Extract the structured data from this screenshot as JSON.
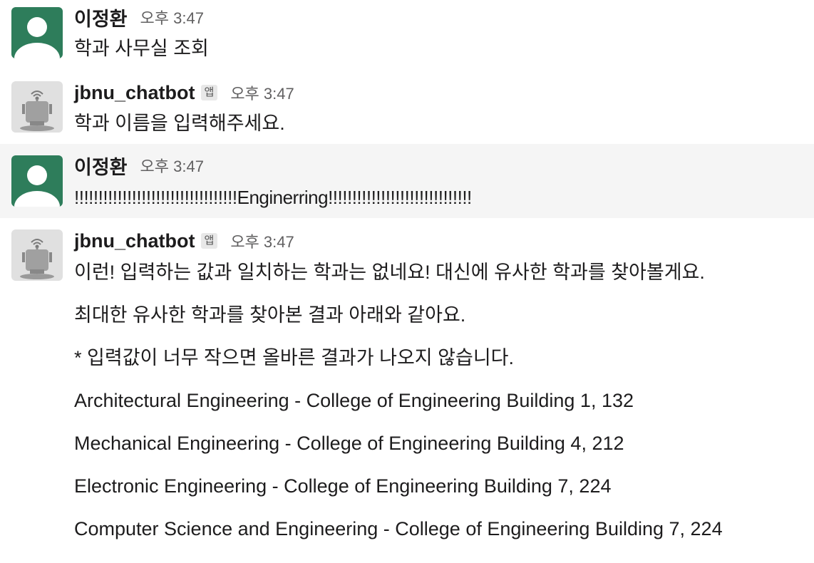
{
  "messages": [
    {
      "sender": "이정환",
      "time": "오후 3:47",
      "lines": [
        "학과 사무실 조회"
      ]
    },
    {
      "sender": "jbnu_chatbot",
      "badge": "앱",
      "time": "오후 3:47",
      "lines": [
        "학과 이름을 입력해주세요."
      ]
    },
    {
      "sender": "이정환",
      "time": "오후 3:47",
      "lines": [
        "!!!!!!!!!!!!!!!!!!!!!!!!!!!!!!!!!!Enginerring!!!!!!!!!!!!!!!!!!!!!!!!!!!!!!"
      ]
    },
    {
      "sender": "jbnu_chatbot",
      "badge": "앱",
      "time": "오후 3:47",
      "lines": [
        "이런! 입력하는 값과 일치하는 학과는 없네요! 대신에 유사한 학과를 찾아볼게요.",
        "최대한 유사한 학과를 찾아본 결과 아래와 같아요.",
        "* 입력값이 너무 작으면 올바른 결과가 나오지 않습니다.",
        "Architectural Engineering -  College of Engineering Building 1, 132",
        "Mechanical Engineering - College of Engineering Building 4, 212",
        "Electronic Engineering - College of Engineering Building 7, 224",
        "Computer Science and Engineering - College of Engineering Building 7, 224"
      ]
    }
  ],
  "colors": {
    "user_avatar_bg": "#2e7d5b",
    "bot_avatar_bg": "#e0e0e0",
    "highlight_bg": "#f5f5f5"
  },
  "icons": {
    "user_avatar": "default-user-avatar-icon",
    "bot_avatar": "robot-avatar-icon"
  }
}
